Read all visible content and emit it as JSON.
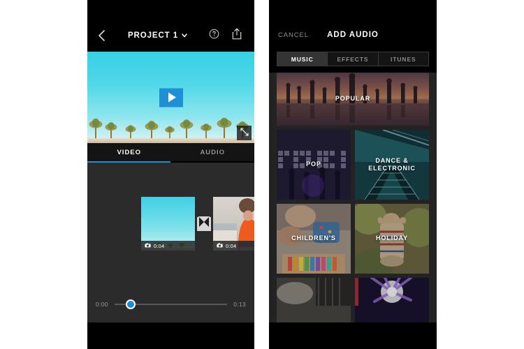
{
  "page": {
    "background": "#ffffff",
    "accent_blue": "#1b8fd4",
    "panel_dark": "#232323"
  },
  "editor": {
    "header": {
      "back_icon": "chevron-left-icon",
      "title": "PROJECT 1",
      "title_caret": "chevron-down-icon",
      "help_icon": "question-circle-icon",
      "share_icon": "share-upload-icon"
    },
    "preview": {
      "play_icon": "play-icon",
      "expand_icon": "expand-fullscreen-icon",
      "scene_description": "palm trees against turquoise sky"
    },
    "tabs": [
      {
        "label": "VIDEO",
        "active": true
      },
      {
        "label": "AUDIO",
        "active": false
      }
    ],
    "timeline": {
      "clips": [
        {
          "duration": "0:04",
          "icon": "camera-icon",
          "scene": "palm trees sky"
        },
        {
          "duration": "0:04",
          "icon": "camera-icon",
          "scene": "person in orange shirt"
        }
      ],
      "transition_icon": "cross-dissolve-transition-icon"
    },
    "scrubber": {
      "start_time": "0:00",
      "end_time": "0:13",
      "playhead_position_percent": 6
    }
  },
  "audio_picker": {
    "cancel_label": "CANCEL",
    "title": "ADD AUDIO",
    "segments": [
      {
        "label": "MUSIC",
        "active": true
      },
      {
        "label": "EFFECTS",
        "active": false
      },
      {
        "label": "ITUNES",
        "active": false
      }
    ],
    "tiles": [
      {
        "label": "POPULAR",
        "art": "art-popular",
        "size": "wide"
      },
      {
        "label": "POP",
        "art": "art-pop",
        "size": "half"
      },
      {
        "label": "DANCE & ELECTRONIC",
        "art": "art-dance",
        "size": "half"
      },
      {
        "label": "CHILDREN'S",
        "art": "art-children",
        "size": "half"
      },
      {
        "label": "HOLIDAY",
        "art": "art-holiday",
        "size": "half"
      },
      {
        "label": "",
        "art": "art-row4a",
        "size": "half"
      },
      {
        "label": "",
        "art": "art-row4b",
        "size": "half"
      }
    ]
  }
}
